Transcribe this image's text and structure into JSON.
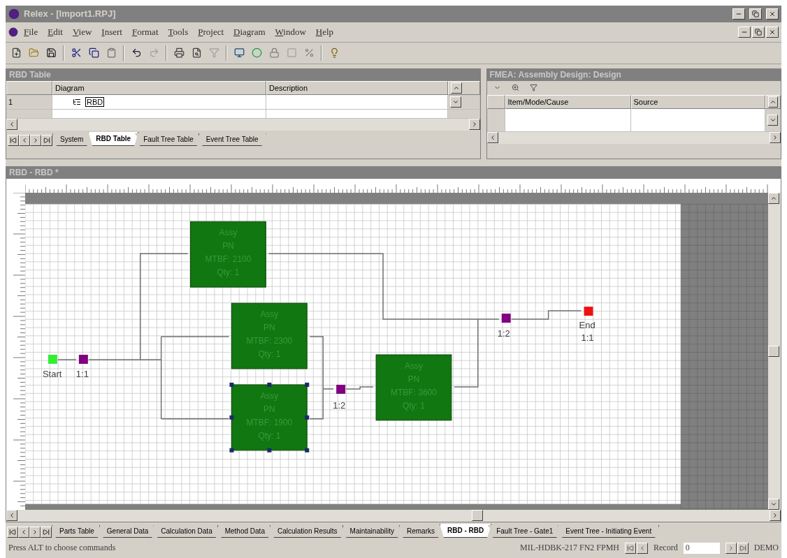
{
  "window": {
    "title": "Relex - [Import1.RPJ]"
  },
  "menu": [
    "File",
    "Edit",
    "View",
    "Insert",
    "Format",
    "Tools",
    "Project",
    "Diagram",
    "Window",
    "Help"
  ],
  "rbd_table": {
    "title": "RBD Table",
    "columns": [
      "Diagram",
      "Description"
    ],
    "rows": [
      {
        "number": "1",
        "diagram": "RBD",
        "description": ""
      }
    ],
    "tabs": [
      {
        "label": "System",
        "selected": false
      },
      {
        "label": "RBD Table",
        "selected": true
      },
      {
        "label": "Fault Tree Table",
        "selected": false
      },
      {
        "label": "Event Tree Table",
        "selected": false
      }
    ]
  },
  "fmea": {
    "title": "FMEA: Assembly Design: Design",
    "columns": [
      "Item/Mode/Cause",
      "Source"
    ]
  },
  "rbd_window": {
    "title": "RBD - RBD *",
    "blocks": [
      {
        "lines": [
          "Assy",
          "PN",
          "MTBF: 2100",
          "Qty: 1"
        ],
        "selected": false
      },
      {
        "lines": [
          "Assy",
          "PN",
          "MTBF: 2300",
          "Qty: 1"
        ],
        "selected": false
      },
      {
        "lines": [
          "Assy",
          "PN",
          "MTBF: 1900",
          "Qty: 1"
        ],
        "selected": true
      },
      {
        "lines": [
          "Assy",
          "PN",
          "MTBF: 3600",
          "Qty: 1"
        ],
        "selected": false
      }
    ],
    "nodes": [
      {
        "kind": "start",
        "labels": [
          "Start"
        ]
      },
      {
        "kind": "kofn",
        "labels": [
          "1:1"
        ]
      },
      {
        "kind": "kofn",
        "labels": [
          "1:2"
        ]
      },
      {
        "kind": "kofn",
        "labels": [
          "1:2"
        ]
      },
      {
        "kind": "end",
        "labels": [
          "End",
          "1:1"
        ]
      }
    ]
  },
  "sheet_tabs": [
    {
      "label": "Parts Table",
      "selected": false
    },
    {
      "label": "General Data",
      "selected": false
    },
    {
      "label": "Calculation Data",
      "selected": false
    },
    {
      "label": "Method Data",
      "selected": false
    },
    {
      "label": "Calculation Results",
      "selected": false
    },
    {
      "label": "Maintainability",
      "selected": false
    },
    {
      "label": "Remarks",
      "selected": false
    },
    {
      "label": "RBD - RBD",
      "selected": true
    },
    {
      "label": "Fault Tree - Gate1",
      "selected": false
    },
    {
      "label": "Event Tree - Initiating Event",
      "selected": false
    }
  ],
  "status_bar": {
    "message": "Press ALT to choose commands",
    "method": "MIL-HDBK-217 FN2 FPMH",
    "record_label": "Record",
    "record_value": "0",
    "mode": "DEMO"
  }
}
